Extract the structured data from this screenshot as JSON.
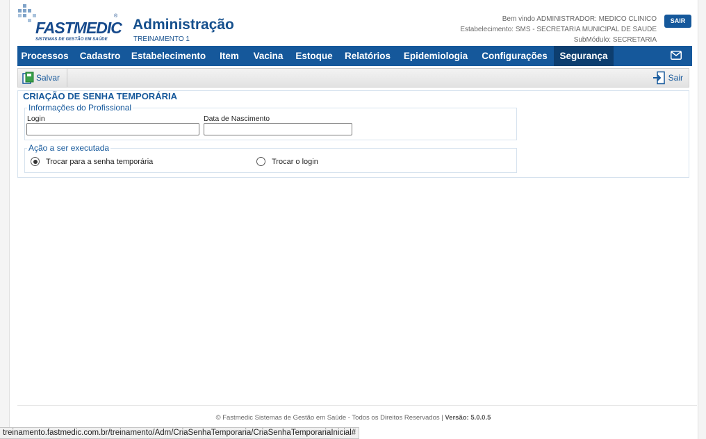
{
  "header": {
    "logo_text": "FASTMEDIC",
    "logo_tagline": "SISTEMAS DE GESTÃO EM SAÚDE",
    "app_title": "Administração",
    "app_subtitle": "TREINAMENTO 1",
    "welcome": "Bem vindo ADMINISTRADOR: MEDICO CLINICO",
    "establishment": "Estabelecimento: SMS - SECRETARIA MUNICIPAL DE SAUDE",
    "submodule": "SubMódulo: SECRETARIA",
    "logout_label": "SAIR"
  },
  "nav": {
    "items": [
      {
        "label": "Processos"
      },
      {
        "label": "Cadastro"
      },
      {
        "label": "Estabelecimento"
      },
      {
        "label": "Item"
      },
      {
        "label": "Vacina"
      },
      {
        "label": "Estoque"
      },
      {
        "label": "Relatórios"
      },
      {
        "label": "Epidemiologia"
      },
      {
        "label": "Configurações"
      },
      {
        "label": "Segurança"
      }
    ],
    "active": "Segurança"
  },
  "toolbar": {
    "save_label": "Salvar",
    "exit_label": "Sair"
  },
  "form": {
    "title": "CRIAÇÃO DE SENHA TEMPORÁRIA",
    "professional_section": "Informações do Profissional",
    "login_label": "Login",
    "login_value": "",
    "birthdate_label": "Data de Nascimento",
    "birthdate_value": "",
    "action_section": "Ação a ser executada",
    "action_option_1": "Trocar para a senha temporária",
    "action_option_2": "Trocar o login",
    "selected_action": "Trocar para a senha temporária"
  },
  "footer": {
    "copyright": "© Fastmedic Sistemas de Gestão em Saúde - Todos os Direitos Reservados |",
    "version": "Versão: 5.0.0.5"
  },
  "status_bar": {
    "url": "treinamento.fastmedic.com.br/treinamento/Adm/CriaSenhaTemporaria/CriaSenhaTemporariaInicial#"
  },
  "colors": {
    "brand_blue": "#15589b",
    "active_nav": "#0d3e6f"
  }
}
